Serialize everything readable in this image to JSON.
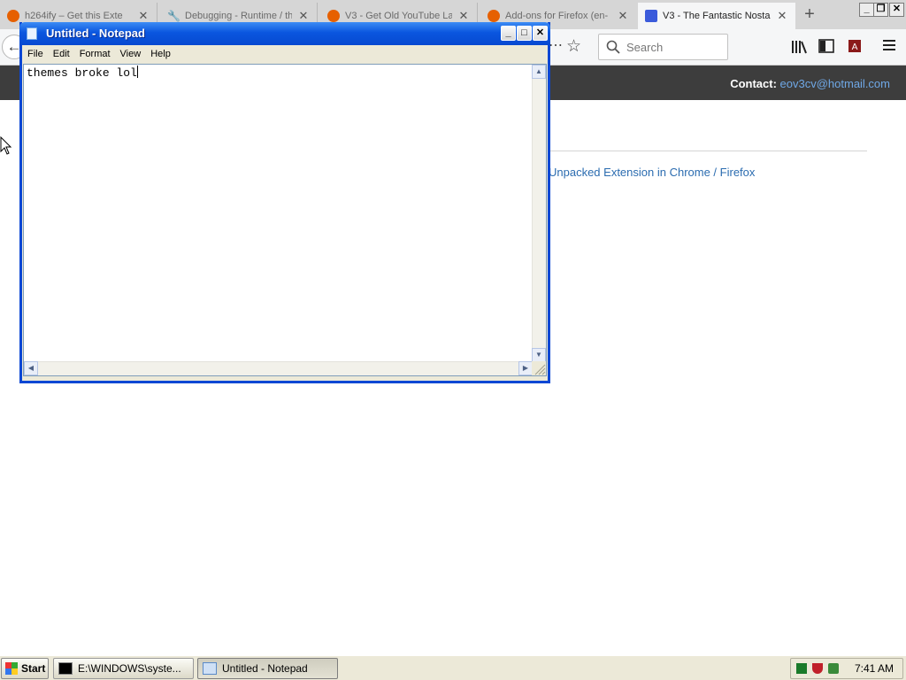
{
  "firefox": {
    "tabs": [
      {
        "title": "h264ify – Get this Exte",
        "fav_color": "#e66000"
      },
      {
        "title": "Debugging - Runtime / th",
        "fav_color": "#5a5a5a"
      },
      {
        "title": "V3 - Get Old YouTube La",
        "fav_color": "#e66000"
      },
      {
        "title": "Add-ons for Firefox (en-",
        "fav_color": "#e66000"
      },
      {
        "title": "V3 - The Fantastic Nosta",
        "fav_color": "#3b5bdb"
      }
    ],
    "search_placeholder": "Search",
    "page": {
      "contact_label": "Contact:",
      "contact_email": "eov3cv@hotmail.com",
      "link_text": "Unpacked Extension in Chrome / Firefox"
    }
  },
  "notepad": {
    "title": "Untitled - Notepad",
    "menu": [
      "File",
      "Edit",
      "Format",
      "View",
      "Help"
    ],
    "content": "themes broke lol"
  },
  "taskbar": {
    "start_label": "Start",
    "buttons": [
      {
        "label": "E:\\WINDOWS\\syste...",
        "active": false
      },
      {
        "label": "Untitled - Notepad",
        "active": true
      }
    ],
    "clock": "7:41 AM"
  },
  "colors": {
    "xp_title_blue": "#0a56df",
    "site_header": "#3d3d3d",
    "link_blue": "#2b6cb0"
  }
}
